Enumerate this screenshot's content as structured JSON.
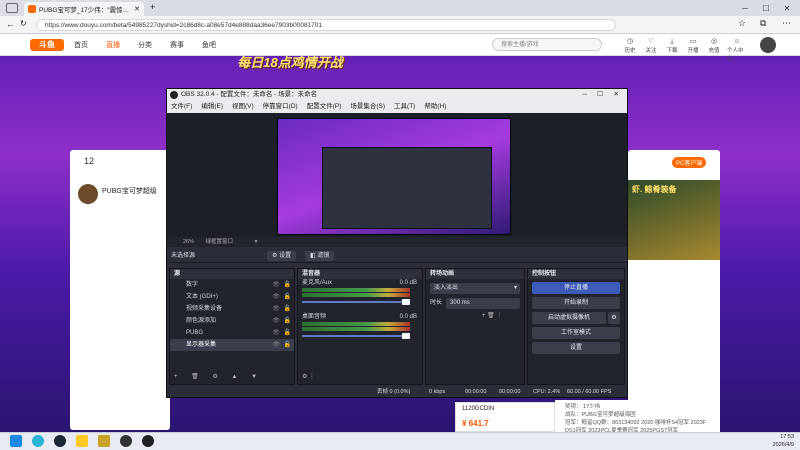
{
  "browser": {
    "tab_title": "PUBG宝可梦_17少伟：\"震惊_17少\"",
    "url": "https://www.douyu.com/beta/54985227dyshid=2c86d8c-a08e57d4e888daa36ee7903b00081701"
  },
  "site": {
    "logo": "斗鱼",
    "nav": [
      "首页",
      "直播",
      "分类",
      "赛事",
      "鱼吧"
    ],
    "search_placeholder": "搜索主播/游戏",
    "header_icons": [
      "历史",
      "关注",
      "下载",
      "开播",
      "充值",
      "个人中心"
    ],
    "banner": "每日18点鸡情开战",
    "side_count": "12",
    "streamer_name": "PUBG宝可梦超级",
    "right_banner": "虾. 鲸肴装备",
    "right_tag": "PC客户端",
    "gift_label": "1120GCDIN",
    "gift_price": "¥ 641.7",
    "desc_lines": [
      "奖项：  17少伟",
      "战队：PUBG宝可梦超级海团",
      "冠军：鲸鲨QQ群：863134092 2020 咖啡杯S4冠军 2023F",
      "DS1冠军 2023PCL夏季赛冠军 2025PGS7冠军"
    ]
  },
  "obs": {
    "title": "OBS 32.0.4 - 配置文件：未命名 - 场景：未命名",
    "menu": [
      "文件(F)",
      "编辑(E)",
      "视图(V)",
      "停靠窗口(D)",
      "配置文件(P)",
      "场景集合(S)",
      "工具(T)",
      "帮助(H)"
    ],
    "zoom": "26%",
    "zoom_label": "绿框置窗口",
    "no_source": "未选择源",
    "settings_btn": "设置",
    "filters_btn": "滤镜",
    "sources_title": "源",
    "sources": [
      {
        "name": "数字",
        "selected": false
      },
      {
        "name": "文本 (GDI+)",
        "selected": false
      },
      {
        "name": "视频采集设备",
        "selected": false
      },
      {
        "name": "颜色源添加",
        "selected": false
      },
      {
        "name": "PUBG",
        "selected": false
      },
      {
        "name": "显示器采集",
        "selected": true
      }
    ],
    "mixer_title": "混音器",
    "mixer": [
      {
        "name": "麦克风/Aux",
        "db": "0.0 dB"
      },
      {
        "name": "桌面音频",
        "db": "0.0 dB"
      }
    ],
    "transitions_title": "转场动画",
    "transition": "淡入淡出",
    "duration_label": "时长",
    "duration": "300 ms",
    "controls_title": "控制按钮",
    "controls": [
      "停止直播",
      "开始录制",
      "启动虚拟摄像机",
      "工作室模式",
      "设置"
    ],
    "status": {
      "dropped": "丢帧 0 (0.0%)",
      "kbps": "0 kbps",
      "stream_time": "00:00:00",
      "rec_time": "00:00:00",
      "cpu": "CPU: 2.4%",
      "fps": "60.00 / 60.00 FPS"
    }
  },
  "taskbar": {
    "time": "17:53",
    "date": "2026/4/9"
  },
  "colors": {
    "accent": "#ff5500",
    "obs_blue": "#3c5bb8",
    "obs_bg": "#2b2e38"
  }
}
